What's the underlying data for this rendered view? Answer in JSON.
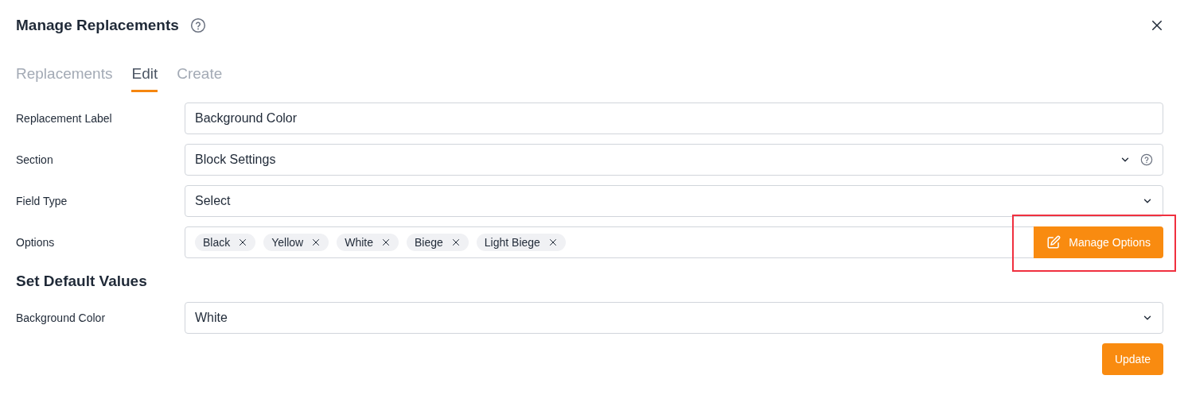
{
  "dialog": {
    "title": "Manage Replacements"
  },
  "tabs": [
    {
      "label": "Replacements",
      "selected": false
    },
    {
      "label": "Edit",
      "selected": true
    },
    {
      "label": "Create",
      "selected": false
    }
  ],
  "fields": [
    {
      "kind": "text",
      "label": "Replacement Label",
      "value": "Background Color"
    },
    {
      "kind": "select",
      "label": "Section",
      "value": "Block Settings",
      "help": true
    },
    {
      "kind": "select",
      "label": "Field Type",
      "value": "Select",
      "help": false
    },
    {
      "kind": "tags",
      "label": "Options",
      "tags": [
        "Black",
        "Yellow",
        "White",
        "Biege",
        "Light Biege"
      ],
      "button": {
        "label": "Manage Options",
        "highlighted": true
      }
    }
  ],
  "defaults": {
    "heading": "Set Default Values",
    "fields": [
      {
        "kind": "select",
        "label": "Background Color",
        "value": "White",
        "help": false
      }
    ]
  },
  "buttons": [
    "Update"
  ]
}
